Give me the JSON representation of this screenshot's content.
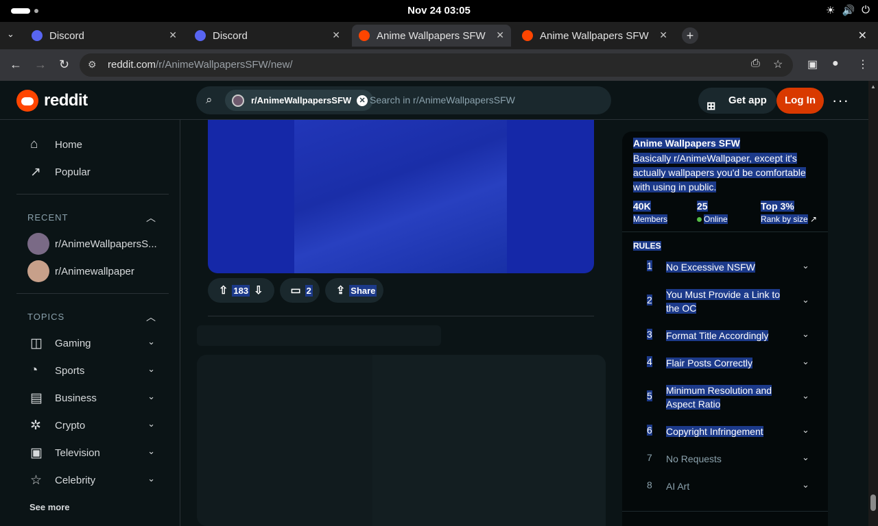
{
  "system": {
    "clock": "Nov 24  03:05"
  },
  "browser": {
    "tabs": [
      {
        "label": "Discord",
        "color": "#5865f2"
      },
      {
        "label": "Discord",
        "color": "#5865f2"
      },
      {
        "label": "Anime Wallpapers SFW",
        "color": "#ff4500"
      },
      {
        "label": "Anime Wallpapers SFW",
        "color": "#ff4500"
      }
    ],
    "url_host": "reddit.com",
    "url_path": "/r/AnimeWallpapersSFW/new/"
  },
  "header": {
    "logo_text": "reddit",
    "search_chip": "r/AnimeWallpapersSFW",
    "search_placeholder": "Search in r/AnimeWallpapersSFW",
    "get_app": "Get app",
    "login": "Log In"
  },
  "sidebar": {
    "home": "Home",
    "popular": "Popular",
    "recent_heading": "RECENT",
    "recent": [
      {
        "label": "r/AnimeWallpapersS..."
      },
      {
        "label": "r/Animewallpaper"
      }
    ],
    "topics_heading": "TOPICS",
    "topics": [
      {
        "label": "Gaming",
        "icon": "gamepad-icon"
      },
      {
        "label": "Sports",
        "icon": "ball-icon"
      },
      {
        "label": "Business",
        "icon": "chart-icon"
      },
      {
        "label": "Crypto",
        "icon": "crypto-icon"
      },
      {
        "label": "Television",
        "icon": "tv-icon"
      },
      {
        "label": "Celebrity",
        "icon": "star-icon"
      }
    ],
    "see_more": "See more"
  },
  "post": {
    "votes": "183",
    "comments": "2",
    "share": "Share"
  },
  "community": {
    "name": "Anime Wallpapers SFW",
    "description": "Basically r/AnimeWallpaper, except it's actually wallpapers you'd be comfortable with using in public.",
    "members_value": "40K",
    "members_label": "Members",
    "online_value": "25",
    "online_label": "Online",
    "rank_value": "Top 3%",
    "rank_label": "Rank by size",
    "rules_heading": "RULES",
    "rules": [
      {
        "n": "1",
        "text": "No Excessive NSFW"
      },
      {
        "n": "2",
        "text": "You Must Provide a Link to the OC"
      },
      {
        "n": "3",
        "text": "Format Title Accordingly"
      },
      {
        "n": "4",
        "text": "Flair Posts Correctly"
      },
      {
        "n": "5",
        "text": "Minimum Resolution and Aspect Ratio"
      },
      {
        "n": "6",
        "text": "Copyright Infringement"
      },
      {
        "n": "7",
        "text": "No Requests"
      },
      {
        "n": "8",
        "text": "AI Art"
      }
    ]
  }
}
